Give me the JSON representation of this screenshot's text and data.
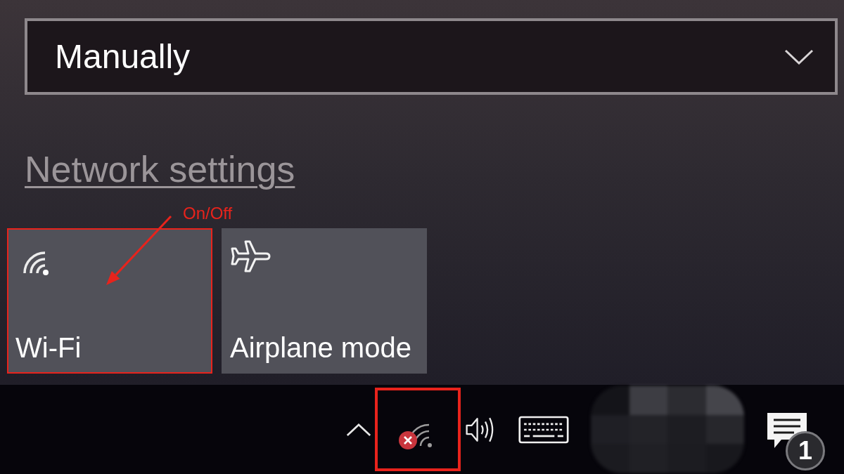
{
  "dropdown": {
    "value": "Manually"
  },
  "network_settings_link": {
    "label": "Network settings"
  },
  "annotation": {
    "label": "On/Off"
  },
  "quick_actions": [
    {
      "kind": "wifi",
      "label": "Wi-Fi",
      "on": false,
      "highlighted": true
    },
    {
      "kind": "airplane",
      "label": "Airplane mode",
      "on": false,
      "highlighted": false
    }
  ],
  "taskbar": {
    "tray_icons": [
      {
        "kind": "chevron",
        "highlighted": false
      },
      {
        "kind": "network_error",
        "highlighted": true
      },
      {
        "kind": "volume",
        "highlighted": false
      },
      {
        "kind": "keyboard",
        "highlighted": false
      }
    ],
    "notifications": {
      "count": "1"
    }
  }
}
